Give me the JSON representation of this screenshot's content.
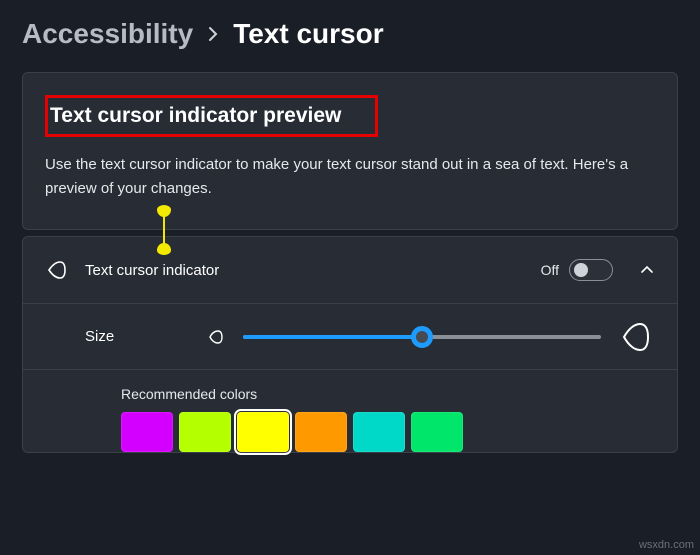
{
  "breadcrumb": {
    "parent": "Accessibility",
    "current": "Text cursor"
  },
  "preview": {
    "title": "Text cursor indicator preview",
    "description": "Use the text cursor indicator to make your text cursor stand out in a sea of text. Here's a preview of your changes."
  },
  "indicator_row": {
    "icon": "cursor-drop-icon",
    "label": "Text cursor indicator",
    "state_label": "Off",
    "toggle_on": false
  },
  "size_row": {
    "label": "Size",
    "min_icon": "cursor-drop-small-icon",
    "max_icon": "cursor-drop-large-icon",
    "value": 50,
    "min": 0,
    "max": 100
  },
  "colors": {
    "label": "Recommended colors",
    "items": [
      {
        "name": "magenta",
        "hex": "#d400ff",
        "selected": false
      },
      {
        "name": "lime",
        "hex": "#b4ff00",
        "selected": false
      },
      {
        "name": "yellow",
        "hex": "#ffff00",
        "selected": true
      },
      {
        "name": "orange",
        "hex": "#ff9900",
        "selected": false
      },
      {
        "name": "cyan",
        "hex": "#00d9c8",
        "selected": false
      },
      {
        "name": "green",
        "hex": "#00e66b",
        "selected": false
      }
    ]
  },
  "watermark": "wsxdn.com"
}
